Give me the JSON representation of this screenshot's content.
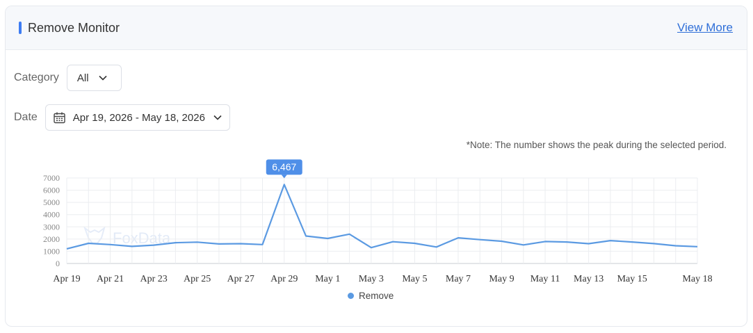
{
  "header": {
    "title": "Remove Monitor",
    "view_more": "View More",
    "accent_color": "#3d7cf2"
  },
  "filters": {
    "category_label": "Category",
    "category_value": "All",
    "date_label": "Date",
    "date_value": "Apr 19, 2026 - May 18, 2026"
  },
  "note": "*Note: The number shows the peak during the selected period.",
  "watermark": "FoxData",
  "chart_data": {
    "type": "line",
    "series": [
      {
        "name": "Remove",
        "color": "#5b9ae2",
        "x": [
          "Apr 19",
          "Apr 20",
          "Apr 21",
          "Apr 22",
          "Apr 23",
          "Apr 24",
          "Apr 25",
          "Apr 26",
          "Apr 27",
          "Apr 28",
          "Apr 29",
          "Apr 30",
          "May 1",
          "May 2",
          "May 3",
          "May 4",
          "May 5",
          "May 6",
          "May 7",
          "May 8",
          "May 9",
          "May 10",
          "May 11",
          "May 12",
          "May 13",
          "May 14",
          "May 15",
          "May 16",
          "May 17",
          "May 18"
        ],
        "values": [
          1200,
          1650,
          1550,
          1400,
          1500,
          1700,
          1750,
          1600,
          1620,
          1550,
          6467,
          2250,
          2050,
          2400,
          1300,
          1780,
          1650,
          1350,
          2100,
          1950,
          1820,
          1520,
          1800,
          1760,
          1620,
          1870,
          1760,
          1630,
          1450,
          1380
        ]
      }
    ],
    "xticks": [
      "Apr 19",
      "Apr 21",
      "Apr 23",
      "Apr 25",
      "Apr 27",
      "Apr 29",
      "May 1",
      "May 3",
      "May 5",
      "May 7",
      "May 9",
      "May 11",
      "May 13",
      "May 15",
      "May 18"
    ],
    "yticks": [
      "0",
      "1000",
      "2000",
      "3000",
      "4000",
      "5000",
      "6000",
      "7000"
    ],
    "ylim": [
      0,
      7000
    ],
    "grid": true,
    "peak_label": "6,467",
    "legend_position": "bottom-center"
  }
}
